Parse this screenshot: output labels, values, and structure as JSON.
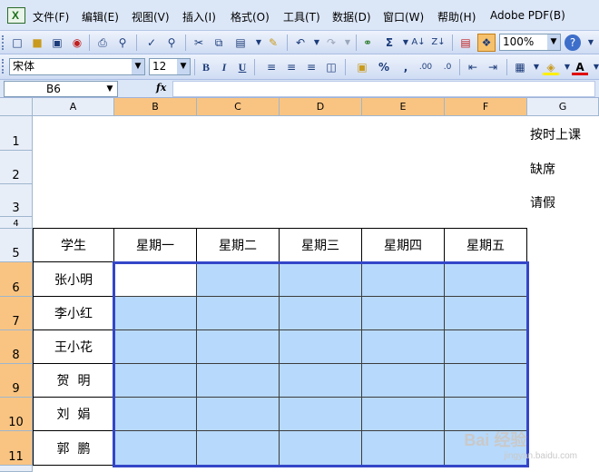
{
  "menu": {
    "items": [
      "文件(F)",
      "编辑(E)",
      "视图(V)",
      "插入(I)",
      "格式(O)",
      "工具(T)",
      "数据(D)",
      "窗口(W)",
      "帮助(H)",
      "Adobe PDF(B)"
    ]
  },
  "toolbar": {
    "zoom": "100%",
    "font_name": "宋体",
    "font_size": "12",
    "bold_label": "B",
    "italic_label": "I",
    "underline_label": "U",
    "percent_label": "%",
    "comma_label": ",",
    "sum_label": "Σ"
  },
  "formula_bar": {
    "name_box": "B6",
    "fx_label": "fx",
    "formula": ""
  },
  "grid": {
    "columns": [
      "A",
      "B",
      "C",
      "D",
      "E",
      "F",
      "G"
    ],
    "rows": [
      "1",
      "2",
      "3",
      "4",
      "5",
      "6",
      "7",
      "8",
      "9",
      "10",
      "11"
    ],
    "header_label": "学生",
    "days": [
      "星期一",
      "星期二",
      "星期三",
      "星期四",
      "星期五"
    ],
    "students": [
      "张小明",
      "李小红",
      "王小花",
      "贺  明",
      "刘  娟",
      "郭  鹏"
    ],
    "legend": [
      "按时上课",
      "缺席",
      "请假"
    ],
    "selected_range_color": "#b7d9fb"
  },
  "watermark": {
    "brand": "Bai 经验",
    "url": "jingyan.baidu.com"
  }
}
